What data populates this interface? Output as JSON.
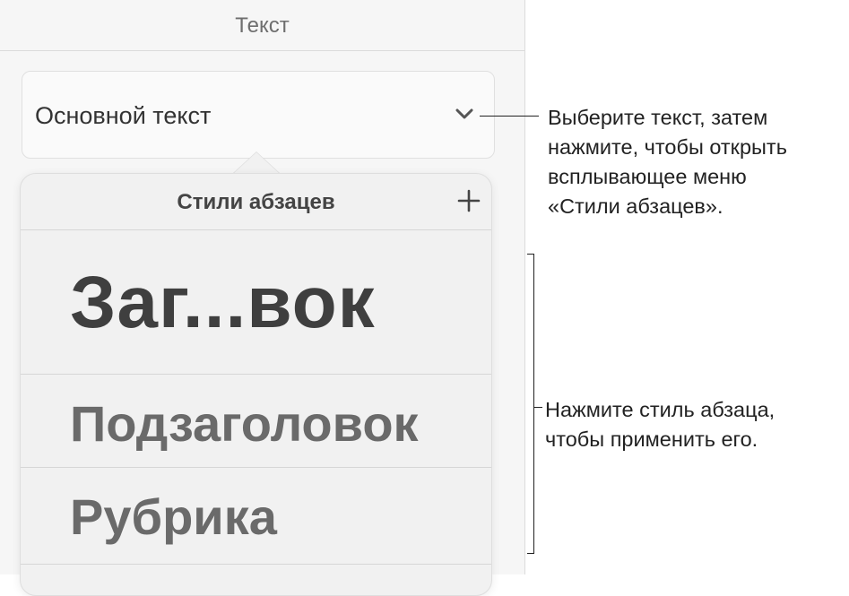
{
  "panel": {
    "header": "Текст",
    "style_selector": {
      "value": "Основной текст",
      "icon": "chevron-down-icon"
    },
    "popover": {
      "title": "Стили абзацев",
      "add_icon": "plus-icon",
      "items": [
        {
          "label": "Заг...вок"
        },
        {
          "label": "Подзаголовок"
        },
        {
          "label": "Рубрика"
        }
      ]
    }
  },
  "callouts": {
    "selector": "Выберите текст, затем\nнажмите, чтобы открыть\nвсплывающее меню\n«Стили абзацев».",
    "styles": "Нажмите стиль абзаца,\nчтобы применить его."
  },
  "colors": {
    "panel_bg": "#f6f6f6",
    "popover_bg": "#f1f1f1",
    "text_dark": "#3f3f3f",
    "text_mid": "#6a6a6a"
  }
}
